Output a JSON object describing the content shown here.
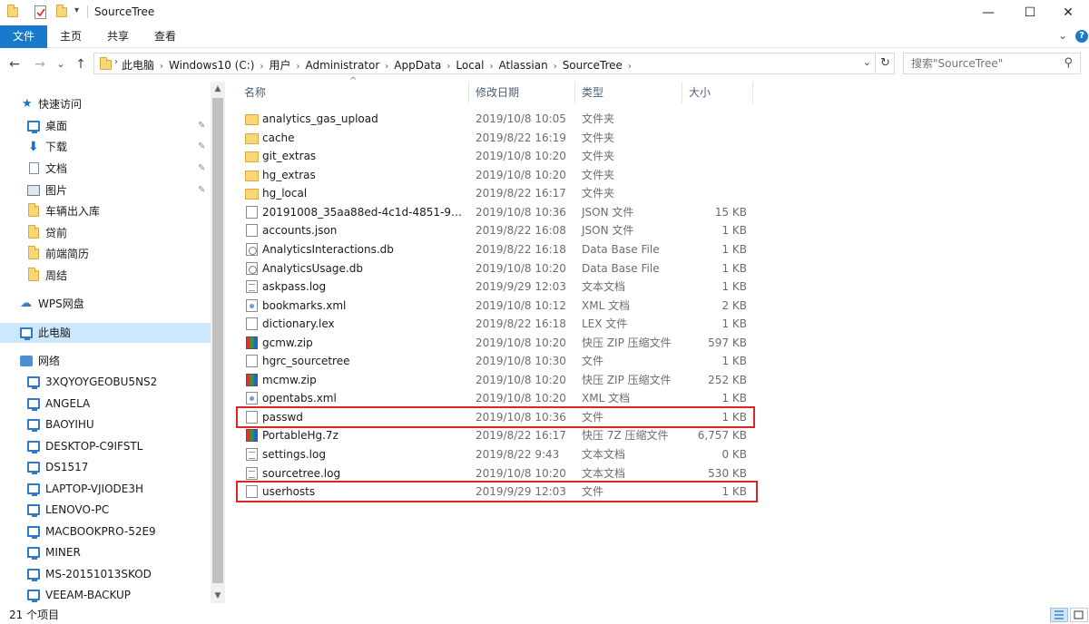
{
  "window": {
    "title": "SourceTree",
    "minimize": "—",
    "maximize": "☐",
    "close": "✕"
  },
  "ribbon": {
    "tabs": [
      "文件",
      "主页",
      "共享",
      "查看"
    ],
    "expand": "⌄",
    "help": "?"
  },
  "nav": {
    "back": "←",
    "forward": "→",
    "recent": "⌄",
    "up": "↑",
    "address_dropdown": "⌄",
    "refresh": "↻"
  },
  "address": {
    "crumbs": [
      "此电脑",
      "Windows10 (C:)",
      "用户",
      "Administrator",
      "AppData",
      "Local",
      "Atlassian",
      "SourceTree"
    ]
  },
  "search": {
    "placeholder": "搜索\"SourceTree\""
  },
  "sidebar": {
    "quick_access": {
      "label": "快速访问",
      "items": [
        {
          "label": "桌面",
          "icon": "desktop-icon",
          "pinned": true
        },
        {
          "label": "下载",
          "icon": "download-icon",
          "pinned": true
        },
        {
          "label": "文档",
          "icon": "documents-icon",
          "pinned": true
        },
        {
          "label": "图片",
          "icon": "pictures-icon",
          "pinned": true
        },
        {
          "label": "车辆出入库",
          "icon": "folder-icon",
          "pinned": false
        },
        {
          "label": "贷前",
          "icon": "folder-icon",
          "pinned": false
        },
        {
          "label": "前端简历",
          "icon": "folder-icon",
          "pinned": false
        },
        {
          "label": "周结",
          "icon": "folder-icon",
          "pinned": false
        }
      ]
    },
    "wps": "WPS网盘",
    "this_pc": "此电脑",
    "network": {
      "label": "网络",
      "items": [
        "3XQYOYGEOBU5NS2",
        "ANGELA",
        "BAOYIHU",
        "DESKTOP-C9IFSTL",
        "DS1517",
        "LAPTOP-VJIODE3H",
        "LENOVO-PC",
        "MACBOOKPRO-52E9",
        "MINER",
        "MS-20151013SKOD",
        "VEEAM-BACKUP"
      ]
    },
    "pin_glyph": "📌",
    "star_glyph": "★",
    "down_glyph": "⬇",
    "cloud_glyph": "☁",
    "expand_glyph": "›"
  },
  "columns": {
    "name": "名称",
    "date": "修改日期",
    "type": "类型",
    "size": "大小",
    "sort_glyph": "^"
  },
  "files": [
    {
      "name": "analytics_gas_upload",
      "date": "2019/10/8 10:05",
      "type": "文件夹",
      "size": "",
      "icon": "folder"
    },
    {
      "name": "cache",
      "date": "2019/8/22 16:19",
      "type": "文件夹",
      "size": "",
      "icon": "folder"
    },
    {
      "name": "git_extras",
      "date": "2019/10/8 10:20",
      "type": "文件夹",
      "size": "",
      "icon": "folder"
    },
    {
      "name": "hg_extras",
      "date": "2019/10/8 10:20",
      "type": "文件夹",
      "size": "",
      "icon": "folder"
    },
    {
      "name": "hg_local",
      "date": "2019/8/22 16:17",
      "type": "文件夹",
      "size": "",
      "icon": "folder"
    },
    {
      "name": "20191008_35aa88ed-4c1d-4851-99b...",
      "date": "2019/10/8 10:36",
      "type": "JSON 文件",
      "size": "15 KB",
      "icon": "file"
    },
    {
      "name": "accounts.json",
      "date": "2019/8/22 16:08",
      "type": "JSON 文件",
      "size": "1 KB",
      "icon": "file"
    },
    {
      "name": "AnalyticsInteractions.db",
      "date": "2019/8/22 16:18",
      "type": "Data Base File",
      "size": "1 KB",
      "icon": "db"
    },
    {
      "name": "AnalyticsUsage.db",
      "date": "2019/10/8 10:20",
      "type": "Data Base File",
      "size": "1 KB",
      "icon": "db"
    },
    {
      "name": "askpass.log",
      "date": "2019/9/29 12:03",
      "type": "文本文档",
      "size": "1 KB",
      "icon": "text"
    },
    {
      "name": "bookmarks.xml",
      "date": "2019/10/8 10:12",
      "type": "XML 文档",
      "size": "2 KB",
      "icon": "xml"
    },
    {
      "name": "dictionary.lex",
      "date": "2019/8/22 16:18",
      "type": "LEX 文件",
      "size": "1 KB",
      "icon": "file"
    },
    {
      "name": "gcmw.zip",
      "date": "2019/10/8 10:20",
      "type": "快压 ZIP 压缩文件",
      "size": "597 KB",
      "icon": "zip"
    },
    {
      "name": "hgrc_sourcetree",
      "date": "2019/10/8 10:30",
      "type": "文件",
      "size": "1 KB",
      "icon": "file"
    },
    {
      "name": "mcmw.zip",
      "date": "2019/10/8 10:20",
      "type": "快压 ZIP 压缩文件",
      "size": "252 KB",
      "icon": "zip"
    },
    {
      "name": "opentabs.xml",
      "date": "2019/10/8 10:20",
      "type": "XML 文档",
      "size": "1 KB",
      "icon": "xml"
    },
    {
      "name": "passwd",
      "date": "2019/10/8 10:36",
      "type": "文件",
      "size": "1 KB",
      "icon": "file"
    },
    {
      "name": "PortableHg.7z",
      "date": "2019/8/22 16:17",
      "type": "快压 7Z 压缩文件",
      "size": "6,757 KB",
      "icon": "zip"
    },
    {
      "name": "settings.log",
      "date": "2019/8/22 9:43",
      "type": "文本文档",
      "size": "0 KB",
      "icon": "text"
    },
    {
      "name": "sourcetree.log",
      "date": "2019/10/8 10:20",
      "type": "文本文档",
      "size": "530 KB",
      "icon": "text"
    },
    {
      "name": "userhosts",
      "date": "2019/9/29 12:03",
      "type": "文件",
      "size": "1 KB",
      "icon": "file"
    }
  ],
  "status": {
    "text": "21 个项目"
  },
  "colors": {
    "accent": "#1979ca",
    "selection": "#cce8ff",
    "highlight_box": "#e02424"
  }
}
